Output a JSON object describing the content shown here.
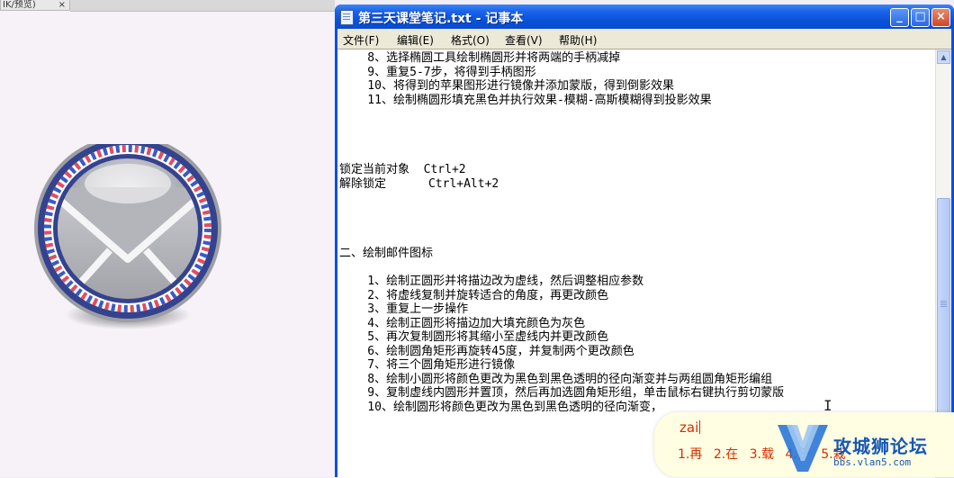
{
  "left_tab": {
    "label": "IK/预览)",
    "close": "×"
  },
  "notepad": {
    "title": "第三天课堂笔记.txt - 记事本",
    "buttons": {
      "minimize": "_",
      "maximize": "□",
      "close": "×"
    },
    "menu": [
      "文件(F)",
      "编辑(E)",
      "格式(O)",
      "查看(V)",
      "帮助(H)"
    ],
    "lines": [
      "    8、选择椭圆工具绘制椭圆形并将两端的手柄减掉",
      "    9、重复5-7步，将得到手柄图形",
      "    10、将得到的苹果图形进行镜像并添加蒙版，得到倒影效果",
      "    11、绘制椭圆形填充黑色并执行效果-模糊-高斯模糊得到投影效果",
      "",
      "",
      "",
      "",
      "锁定当前对象  Ctrl+2",
      "解除锁定      Ctrl+Alt+2",
      "",
      "",
      "",
      "",
      "二、绘制邮件图标",
      "",
      "    1、绘制正圆形并将描边改为虚线，然后调整相应参数",
      "    2、将虚线复制并旋转适合的角度，再更改颜色",
      "    3、重复上一步操作",
      "    4、绘制正圆形将描边加大填充颜色为灰色",
      "    5、再次复制圆形将其缩小至虚线内并更改颜色",
      "    6、绘制圆角矩形再旋转45度，并复制两个更改颜色",
      "    7、将三个圆角矩形进行镜像",
      "    8、绘制小圆形将颜色更改为黑色到黑色透明的径向渐变并与两组圆角矩形编组",
      "    9、复制虚线内圆形并置顶，然后再加选圆角矩形组，单击鼠标右键执行剪切蒙版",
      "    10、绘制圆形将颜色更改为黑色到黑色透明的径向渐变，"
    ]
  },
  "ime": {
    "composition": "zai",
    "candidates": [
      "1.再",
      "2.在",
      "3.载",
      "4.仔",
      "5.栽"
    ]
  },
  "watermark": {
    "title": "攻城狮论坛",
    "url": "bbs.vlan5.com"
  }
}
